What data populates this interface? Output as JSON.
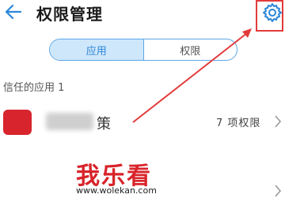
{
  "header": {
    "title": "权限管理"
  },
  "tabs": [
    {
      "label": "应用",
      "active": true
    },
    {
      "label": "权限",
      "active": false
    }
  ],
  "section": {
    "label": "信任的应用 1"
  },
  "app": {
    "name_visible": "策",
    "permissions": "7 项权限"
  },
  "watermark": {
    "text": "我乐看",
    "url": "www.wolekan.com"
  },
  "colors": {
    "accent": "#2b86d8",
    "annotation": "#e23b3b",
    "watermark": "#d8232a"
  },
  "icons": {
    "back": "back-arrow-icon",
    "settings": "gear-icon",
    "chevron": "chevron-right-icon"
  }
}
